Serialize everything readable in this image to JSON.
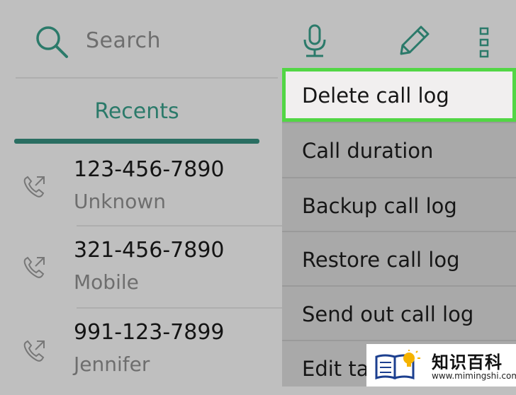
{
  "header": {
    "search_placeholder": "Search",
    "icons": [
      "search-icon",
      "microphone-icon",
      "pencil-icon",
      "more-vertical-icon"
    ]
  },
  "tabs": [
    {
      "label": "Recents",
      "active": true
    }
  ],
  "calls": [
    {
      "number": "123-456-7890",
      "label": "Unknown",
      "icon": "call-incoming-icon"
    },
    {
      "number": "321-456-7890",
      "label": "Mobile",
      "icon": "call-incoming-icon"
    },
    {
      "number": "991-123-7899",
      "label": "Jennifer",
      "icon": "call-incoming-icon"
    }
  ],
  "menu": {
    "items": [
      {
        "label": "Delete call log",
        "highlighted": true
      },
      {
        "label": "Call duration"
      },
      {
        "label": "Backup call log"
      },
      {
        "label": "Restore call log"
      },
      {
        "label": "Send out call log"
      },
      {
        "label": "Edit ta"
      }
    ]
  },
  "watermark": {
    "cn_text": "知识百科",
    "url": "www.mimingshi.com"
  },
  "colors": {
    "background": "#bfbfbf",
    "accent": "#2b7a6a",
    "menu_background": "#a9a9a9",
    "highlight_border": "#52d645",
    "highlight_fill": "#f1efef"
  }
}
